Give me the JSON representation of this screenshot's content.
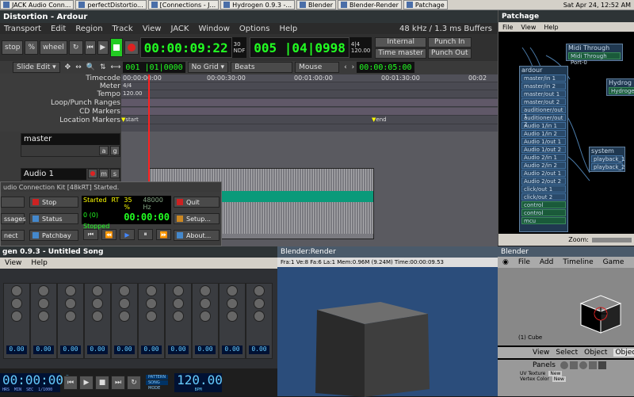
{
  "taskbar": {
    "tasks": [
      "JACK Audio Conn...",
      "perfectDistortio...",
      "[Connections - J...",
      "Hydrogen 0.9.3 -...",
      "Blender",
      "Blender-Render",
      "Patchage"
    ],
    "clock": "Sat Apr 24, 12:52 AM"
  },
  "ardour": {
    "title": "Distortion - Ardour",
    "menu": [
      "Transport",
      "Edit",
      "Region",
      "Track",
      "View",
      "JACK",
      "Window",
      "Options",
      "Help"
    ],
    "status_right": "48 kHz / 1.3 ms  Buffers",
    "transport": {
      "stop_label": "stop",
      "percent_label": "%",
      "wheel_label": "wheel"
    },
    "primary_clock": "00:00:09:22",
    "fps": "30",
    "ndf": "NDF",
    "secondary_clock": "005 |04|0998",
    "meter_sig": "4|4",
    "tempo": "120.00",
    "sync_internal": "Internal",
    "time_master": "Time master",
    "punch_in": "Punch In",
    "punch_out": "Punch Out",
    "edit_mode": "Slide Edit",
    "nudge_clock": "001 |01|0000",
    "grid": "No Grid",
    "snap": "Beats",
    "mouse": "Mouse",
    "nudge_time": "00:00:05:00",
    "ruler_labels": [
      "Timecode",
      "Meter",
      "Tempo",
      "Loop/Punch Ranges",
      "CD Markers",
      "Location Markers"
    ],
    "timecode_ticks": [
      "00:00:00:00",
      "00:00:30:00",
      "00:01:00:00",
      "00:01:30:00",
      "00:02"
    ],
    "meter_value": "4/4",
    "tempo_value": "120.00",
    "marker_start": "start",
    "marker_end": "end",
    "master_track": "master",
    "audio_track": "Audio 1",
    "g_label": "g",
    "a_label": "a",
    "s_label": "s"
  },
  "patchage": {
    "title": "Patchage",
    "menu": [
      "File",
      "View",
      "Help"
    ],
    "modules": {
      "midi_through": {
        "title": "Midi Through",
        "ports": [
          "Midi Through Port-0"
        ]
      },
      "ardour": {
        "title": "ardour",
        "ports": [
          "master/in 1",
          "master/in 2",
          "master/out 1",
          "master/out 2",
          "auditioner/out 1",
          "auditioner/out 2",
          "Audio 1/in 1",
          "Audio 1/in 2",
          "Audio 1/out 1",
          "Audio 1/out 2",
          "Audio 2/in 1",
          "Audio 2/in 2",
          "Audio 2/out 1",
          "Audio 2/out 2",
          "click/out 1",
          "click/out 2",
          "control",
          "control",
          "mcu"
        ]
      },
      "system": {
        "title": "system",
        "ports": [
          "playback_1",
          "playback_2"
        ]
      },
      "hydrogen": {
        "title": "Hydrog",
        "ports": [
          "Hydrogen"
        ]
      }
    },
    "zoom_label": "Zoom:"
  },
  "qjack": {
    "title": "udio Connection Kit [48kRT] Started.",
    "buttons": {
      "stop": "Stop",
      "quit": "Quit",
      "messages": "ssages",
      "status": "Status",
      "setup": "Setup...",
      "connect": "nect",
      "patchbay": "Patchbay",
      "about": "About..."
    },
    "state": "Started",
    "rt": "RT",
    "cpu": "35 %",
    "rate": "48000 Hz",
    "xruns": "0 (0)",
    "time": "00:00:00",
    "transport_state": "Stopped"
  },
  "hydrogen": {
    "title": "gen 0.9.3 - Untitled Song",
    "menu": [
      "View",
      "Help"
    ],
    "strip_values": [
      "0.00",
      "0.00",
      "0.00",
      "0.00",
      "0.00",
      "0.00",
      "0.00",
      "0.00",
      "0.00",
      "0.00"
    ],
    "time": "00:00:000",
    "time_units": [
      "HRS",
      "MIN",
      "SEC",
      "1/1000"
    ],
    "mode_labels": [
      "PATTERN",
      "SONG",
      "MODE"
    ],
    "bpm": "120.00",
    "bpm_label": "BPM"
  },
  "render": {
    "title": "Blender:Render",
    "info": "Fra:1  Ve:8 Fa:6 La:1 Mem:0.96M (9.24M) Time:00:00:09.53"
  },
  "blender": {
    "title": "Blender",
    "menu": [
      "File",
      "Add",
      "Timeline",
      "Game"
    ],
    "object_label": "(1) Cube",
    "view_bar": [
      "View",
      "Select",
      "Object",
      "Object"
    ],
    "panels_label": "Panels",
    "uv_texture": "UV Texture",
    "vertex_color": "Vertex Color",
    "new_label": "New"
  },
  "colors": {
    "clock_green": "#22ff22",
    "playhead": "#ff2020",
    "patch_blue": "#203850",
    "render_bg": "#2b4d7b"
  }
}
